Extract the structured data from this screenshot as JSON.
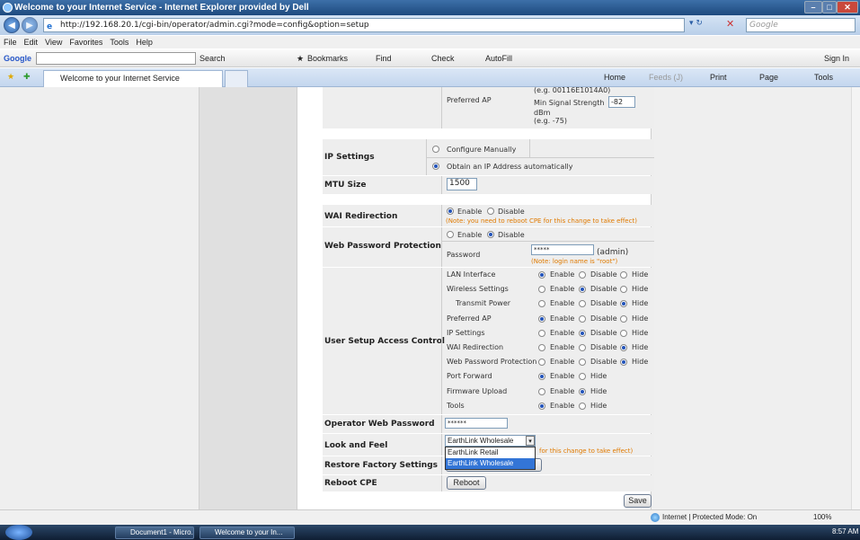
{
  "window": {
    "title": "Welcome to your Internet Service - Internet Explorer provided by Dell"
  },
  "address": {
    "url": "http://192.168.20.1/cgi-bin/operator/admin.cgi?mode=config&option=setup",
    "search_placeholder": "Google"
  },
  "menu": [
    "File",
    "Edit",
    "View",
    "Favorites",
    "Tools",
    "Help"
  ],
  "google_bar": {
    "logo": "Google",
    "search_label": "Search",
    "bookmarks": "Bookmarks",
    "find": "Find",
    "check": "Check",
    "autofill": "AutoFill",
    "sign_in": "Sign In"
  },
  "tab": {
    "title": "Welcome to your Internet Service"
  },
  "cmd_bar": {
    "home": "Home",
    "feeds": "Feeds (J)",
    "print": "Print",
    "page": "Page",
    "tools": "Tools"
  },
  "form": {
    "preferred_ap": {
      "label": "Preferred AP",
      "eg_top": "(e.g. 00116E1014A0)",
      "min_signal": "Min Signal Strength",
      "min_signal_value": "-82",
      "dbm": "dBm",
      "eg": "(e.g. -75)"
    },
    "ip_settings": {
      "label": "IP Settings",
      "opt_manual": "Configure Manually",
      "opt_auto": "Obtain an IP Address automatically"
    },
    "mtu": {
      "label": "MTU Size",
      "value": "1500"
    },
    "wai": {
      "label": "WAI Redirection",
      "enable": "Enable",
      "disable": "Disable",
      "note": "(Note: you need to reboot CPE for this change to take effect)"
    },
    "webpw": {
      "label": "Web Password Protection",
      "enable": "Enable",
      "disable": "Disable",
      "password_label": "Password",
      "password_value": "*****",
      "admin": "(admin)",
      "note": "(Note: login name is \"root\")"
    },
    "usac": {
      "label": "User Setup Access Control",
      "rows": [
        {
          "name": "LAN Interface",
          "opts": [
            "Enable",
            "Disable",
            "Hide"
          ],
          "sel": 0
        },
        {
          "name": "Wireless Settings",
          "opts": [
            "Enable",
            "Disable",
            "Hide"
          ],
          "sel": 1
        },
        {
          "name": "Transmit Power",
          "opts": [
            "Enable",
            "Disable",
            "Hide"
          ],
          "sel": 2
        },
        {
          "name": "Preferred AP",
          "opts": [
            "Enable",
            "Disable",
            "Hide"
          ],
          "sel": 0
        },
        {
          "name": "IP Settings",
          "opts": [
            "Enable",
            "Disable",
            "Hide"
          ],
          "sel": 1
        },
        {
          "name": "WAI Redirection",
          "opts": [
            "Enable",
            "Disable",
            "Hide"
          ],
          "sel": 2
        },
        {
          "name": "Web Password Protection",
          "opts": [
            "Enable",
            "Disable",
            "Hide"
          ],
          "sel": 2
        },
        {
          "name": "Port Forward",
          "opts": [
            "Enable",
            "Hide"
          ],
          "sel": 0
        },
        {
          "name": "Firmware Upload",
          "opts": [
            "Enable",
            "Hide"
          ],
          "sel": 1
        },
        {
          "name": "Tools",
          "opts": [
            "Enable",
            "Hide"
          ],
          "sel": 0
        }
      ]
    },
    "opw": {
      "label": "Operator Web Password",
      "value": "******"
    },
    "laf": {
      "label": "Look and Feel",
      "value": "EarthLink Wholesale",
      "options": [
        "EarthLink Retail",
        "EarthLink Wholesale"
      ],
      "note": "for this change to take effect)"
    },
    "restore": {
      "label": "Restore Factory Settings"
    },
    "reboot": {
      "label": "Reboot CPE",
      "button": "Reboot"
    },
    "save": "Save"
  },
  "status": {
    "zone": "Internet | Protected Mode: On",
    "zoom": "100%"
  },
  "taskbar": {
    "items": [
      "Document1 - Micro...",
      "Welcome to your In..."
    ],
    "time": "8:57 AM"
  }
}
